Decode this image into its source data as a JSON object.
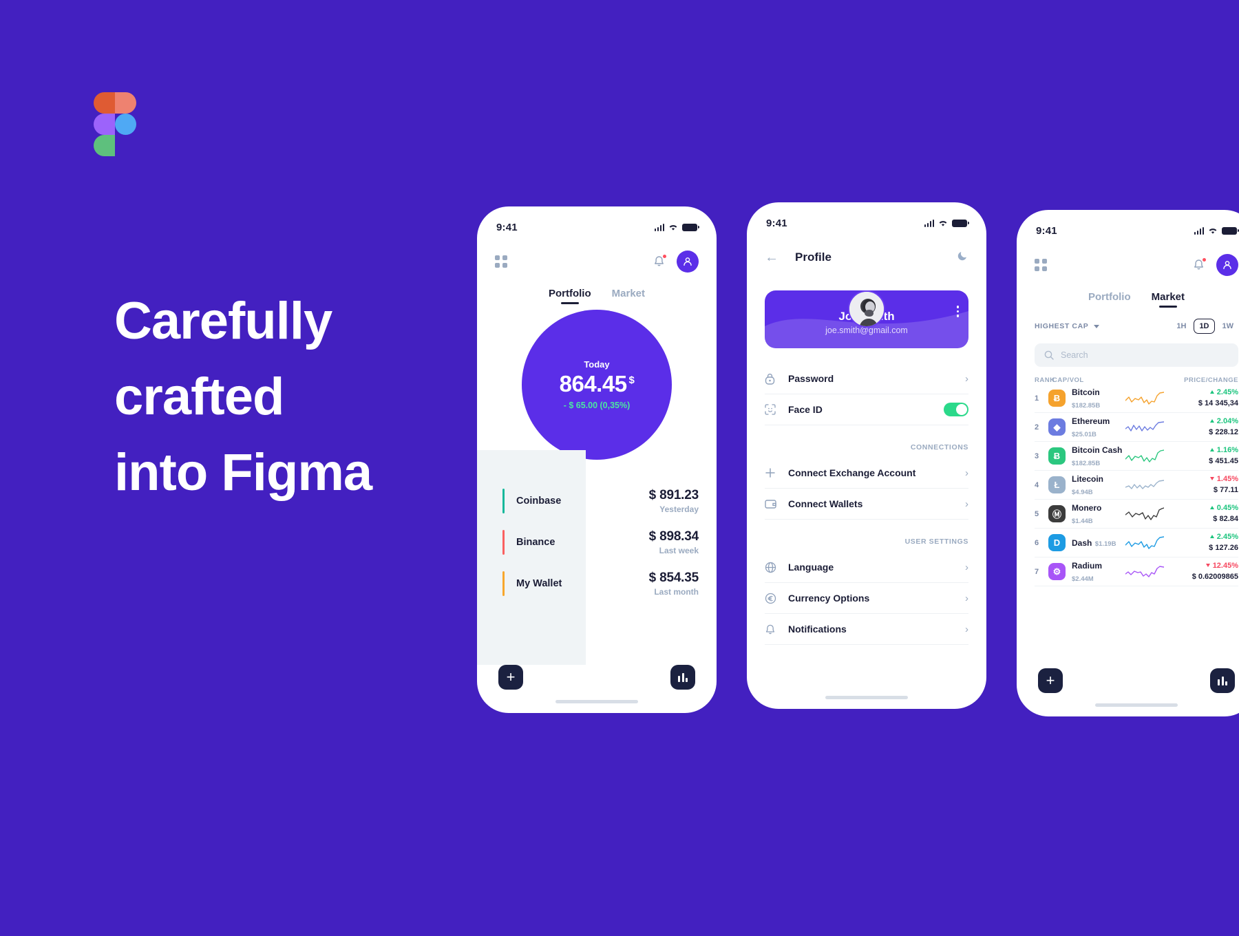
{
  "background_color": "#4320C0",
  "brand": {
    "logo_name": "figma-logo",
    "accent": "#5B2EE8",
    "green": "#2BD98A",
    "red": "#F6475F"
  },
  "headline": "Carefully\ncrafted\ninto Figma",
  "phone1": {
    "status": {
      "time": "9:41"
    },
    "header": {
      "grid_icon": "grid-icon",
      "bell_icon": "bell-icon",
      "avatar": "user-avatar"
    },
    "tabs": [
      {
        "label": "Portfolio",
        "active": true
      },
      {
        "label": "Market",
        "active": false
      }
    ],
    "balance": {
      "period": "Today",
      "amount": "864.45",
      "currency": "$",
      "delta": "- $ 65.00 (0,35%)"
    },
    "assets": [
      {
        "name": "Coinbase",
        "color": "#17B89B",
        "value": "$ 891.23",
        "period": "Yesterday"
      },
      {
        "name": "Binance",
        "color": "#FA6060",
        "value": "$ 898.34",
        "period": "Last week"
      },
      {
        "name": "My Wallet",
        "color": "#F8A72C",
        "value": "$ 854.35",
        "period": "Last month"
      }
    ],
    "fab_add": "add-button",
    "fab_chart": "chart-button"
  },
  "phone2": {
    "status": {
      "time": "9:41"
    },
    "title": "Profile",
    "back_icon": "back-arrow-icon",
    "theme_icon": "moon-icon",
    "profile": {
      "name": "Joe Smith",
      "email": "joe.smith@gmail.com",
      "menu_icon": "more-vertical-icon"
    },
    "security_items": [
      {
        "label": "Password",
        "icon": "lock-icon",
        "type": "link"
      },
      {
        "label": "Face ID",
        "icon": "face-id-icon",
        "type": "toggle",
        "toggle_on": true
      }
    ],
    "connections_label": "CONNECTIONS",
    "connection_items": [
      {
        "label": "Connect Exchange Account",
        "icon": "plus-icon"
      },
      {
        "label": "Connect Wallets",
        "icon": "wallet-icon"
      }
    ],
    "user_settings_label": "USER SETTINGS",
    "settings_items": [
      {
        "label": "Language",
        "icon": "globe-icon"
      },
      {
        "label": "Currency Options",
        "icon": "euro-icon"
      },
      {
        "label": "Notifications",
        "icon": "bell-icon"
      }
    ]
  },
  "phone3": {
    "status": {
      "time": "9:41"
    },
    "tabs": [
      {
        "label": "Portfolio",
        "active": false
      },
      {
        "label": "Market",
        "active": true
      }
    ],
    "sort": {
      "label": "HIGHEST CAP"
    },
    "ranges": [
      {
        "label": "1H",
        "active": false
      },
      {
        "label": "1D",
        "active": true
      },
      {
        "label": "1W",
        "active": false
      }
    ],
    "search": {
      "placeholder": "Search",
      "icon": "search-icon"
    },
    "columns": {
      "rank": "RANK",
      "cap": "CAP/VOL",
      "price": "PRICE/CHANGE"
    },
    "coins": [
      {
        "rank": "1",
        "name": "Bitcoin",
        "cap": "$182.85B",
        "symbol": "Ƀ",
        "icon_bg": "#F5A22D",
        "spark": "#F5A22D",
        "change": "2.45%",
        "up": true,
        "price": "$ 14 345,34"
      },
      {
        "rank": "2",
        "name": "Ethereum",
        "cap": "$25.01B",
        "symbol": "◆",
        "icon_bg": "#6C7CE0",
        "spark": "#6C7CE0",
        "change": "2.04%",
        "up": true,
        "price": "$ 228.12"
      },
      {
        "rank": "3",
        "name": "Bitcoin Cash",
        "cap": "$182.85B",
        "symbol": "Ƀ",
        "icon_bg": "#2BC77F",
        "spark": "#2BC77F",
        "change": "1.16%",
        "up": true,
        "price": "$ 451.45"
      },
      {
        "rank": "4",
        "name": "Litecoin",
        "cap": "$4.94B",
        "symbol": "Ł",
        "icon_bg": "#9AB2CB",
        "spark": "#9AB2CB",
        "change": "1.45%",
        "up": false,
        "price": "$ 77.11"
      },
      {
        "rank": "5",
        "name": "Monero",
        "cap": "$1.44B",
        "symbol": "Ⓜ",
        "icon_bg": "#3C3C3C",
        "spark": "#3C3C3C",
        "change": "0.45%",
        "up": true,
        "price": "$ 82.84"
      },
      {
        "rank": "6",
        "name": "Dash",
        "cap": "$1.19B",
        "symbol": "D",
        "icon_bg": "#1D9BE3",
        "spark": "#1D9BE3",
        "change": "2.45%",
        "up": true,
        "price": "$ 127.26"
      },
      {
        "rank": "7",
        "name": "Radium",
        "cap": "$2.44M",
        "symbol": "⚙",
        "icon_bg": "#A855F7",
        "spark": "#A855F7",
        "change": "12.45%",
        "up": false,
        "price": "$ 0.62009865"
      }
    ],
    "fab_add": "add-button",
    "fab_chart": "chart-button"
  }
}
